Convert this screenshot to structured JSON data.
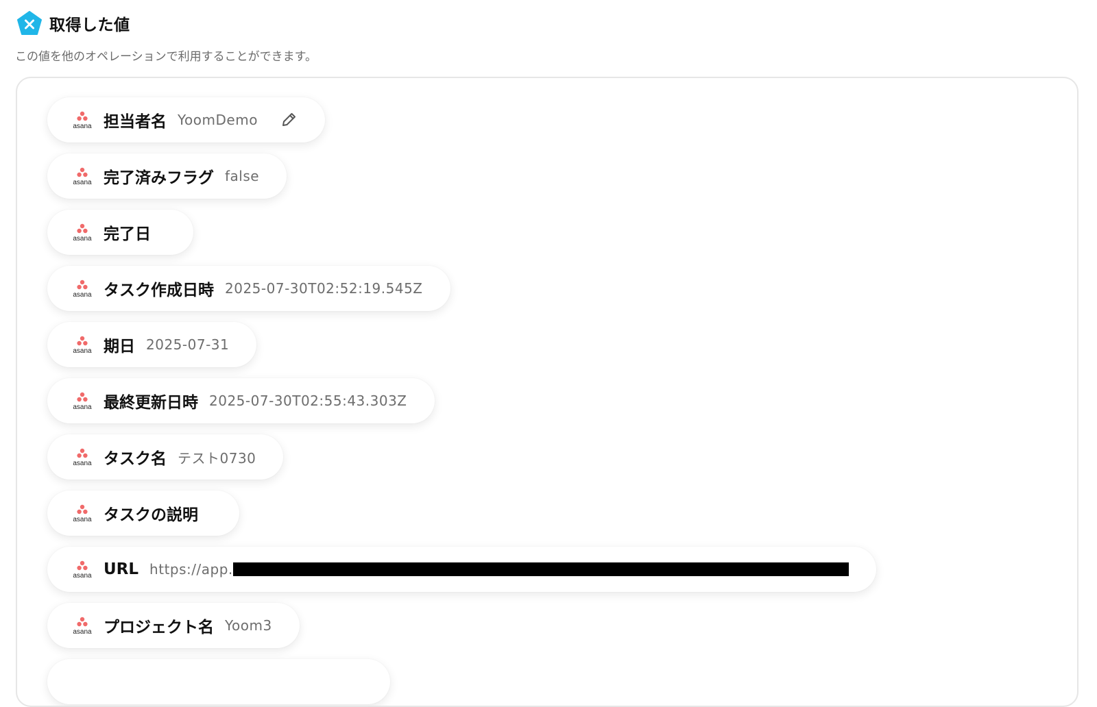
{
  "header": {
    "title": "取得した値",
    "icon": "yoom-variable-icon",
    "icon_color": "#20b6e8"
  },
  "subtitle": "この値を他のオペレーションで利用することができます。",
  "items": [
    {
      "label": "担当者名",
      "value": "YoomDemo",
      "editable": true
    },
    {
      "label": "完了済みフラグ",
      "value": "false"
    },
    {
      "label": "完了日",
      "value": ""
    },
    {
      "label": "タスク作成日時",
      "value": "2025-07-30T02:52:19.545Z"
    },
    {
      "label": "期日",
      "value": "2025-07-31"
    },
    {
      "label": "最終更新日時",
      "value": "2025-07-30T02:55:43.303Z"
    },
    {
      "label": "タスク名",
      "value": "テスト0730"
    },
    {
      "label": "タスクの説明",
      "value": ""
    },
    {
      "label": "URL",
      "value": "https://app.",
      "redacted": true
    },
    {
      "label": "プロジェクト名",
      "value": "Yoom3"
    }
  ],
  "logo": {
    "name": "asana-logo",
    "text": "asana",
    "color": "#f06a6a"
  }
}
